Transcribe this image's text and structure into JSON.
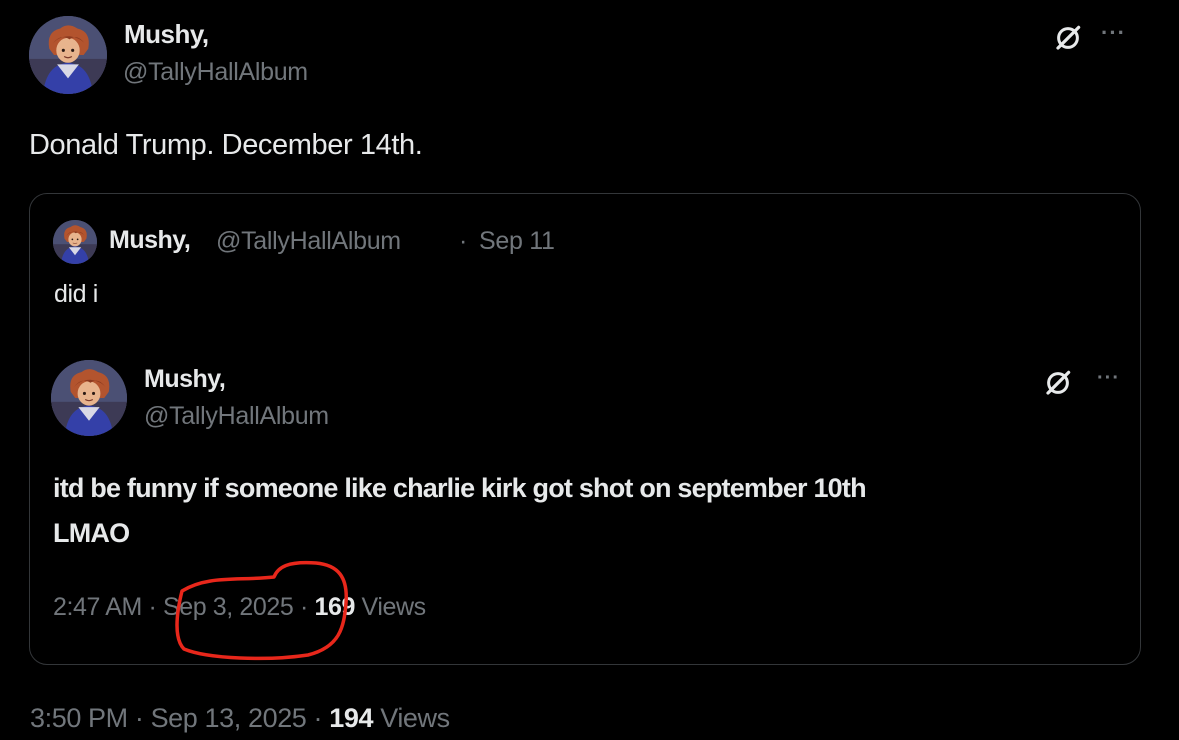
{
  "main_post": {
    "display_name": "Mushy,",
    "handle": "@TallyHallAlbum",
    "text": "Donald Trump. December 14th.",
    "time": "3:50 PM",
    "date": "Sep 13, 2025",
    "views_count": "194",
    "views_label": "Views"
  },
  "quoted_post": {
    "display_name": "Mushy,",
    "handle": "@TallyHallAlbum",
    "date": "Sep 11",
    "text": "did i"
  },
  "embedded_post": {
    "display_name": "Mushy,",
    "handle": "@TallyHallAlbum",
    "text_line1": "itd be funny if someone like charlie kirk got shot on september 10th",
    "text_line2": "LMAO",
    "time": "2:47 AM",
    "date": "Sep 3, 2025",
    "views_count": "169",
    "views_label": "Views"
  },
  "separator": "·",
  "more_glyph": "···",
  "icons": [
    "avatar-image",
    "grok-icon",
    "more-options-icon"
  ],
  "colors": {
    "background": "#000000",
    "text_primary": "#e7e9ea",
    "text_secondary": "#71767b",
    "border": "#333639",
    "annotation": "#e8271b"
  }
}
